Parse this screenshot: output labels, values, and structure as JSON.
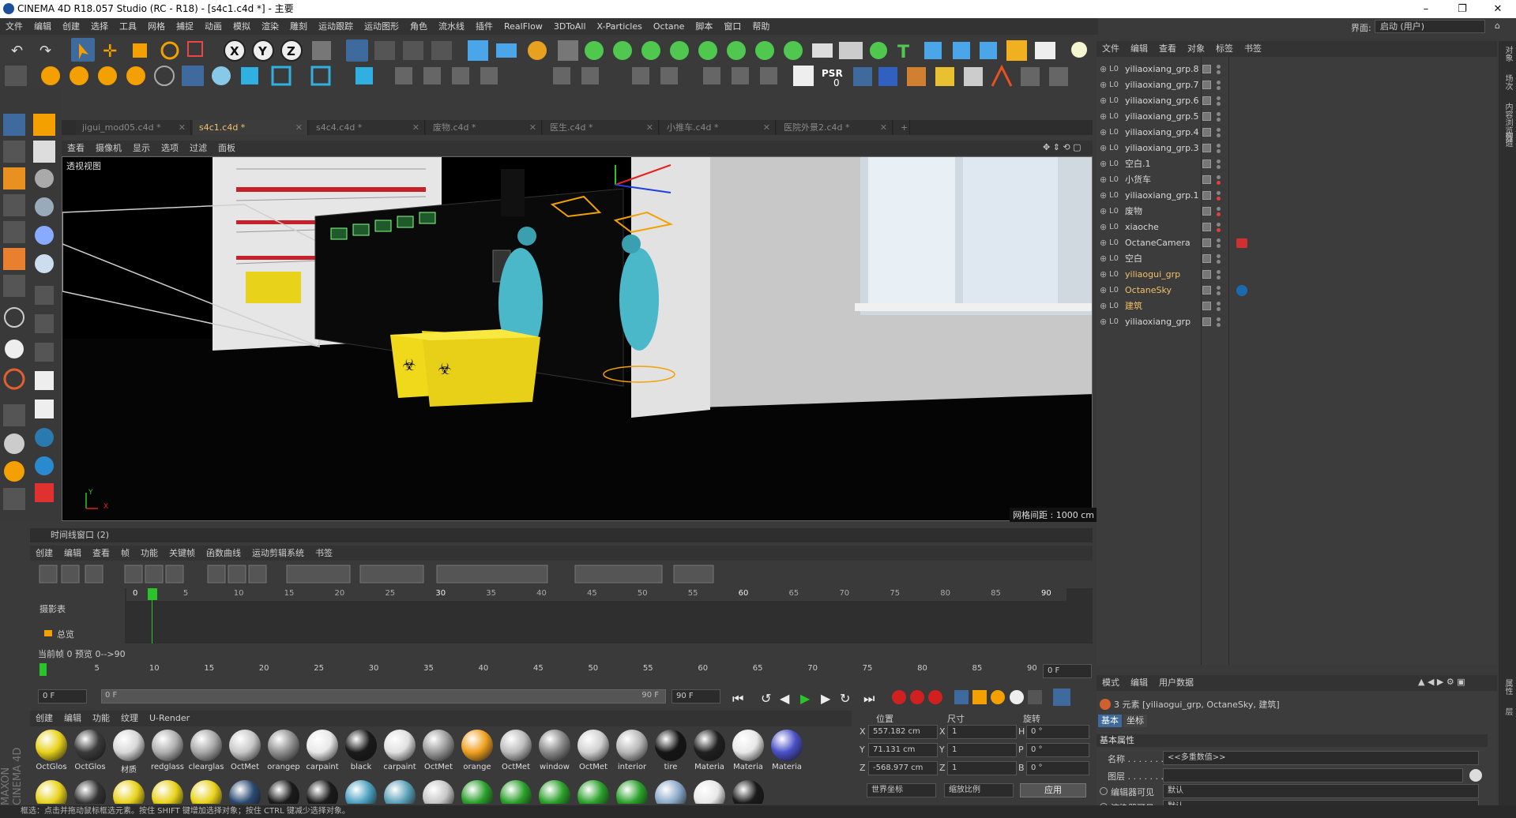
{
  "window": {
    "title": "CINEMA 4D R18.057 Studio (RC - R18) - [s4c1.c4d *] - 主要",
    "layout_label": "界面:",
    "layout_value": "启动 (用户)"
  },
  "menubar": [
    "文件",
    "编辑",
    "创建",
    "选择",
    "工具",
    "网格",
    "捕捉",
    "动画",
    "模拟",
    "渲染",
    "雕刻",
    "运动跟踪",
    "运动图形",
    "角色",
    "流水线",
    "插件",
    "RealFlow",
    "3DToAll",
    "X-Particles",
    "Octane",
    "脚本",
    "窗口",
    "帮助"
  ],
  "psr": {
    "label": "PSR",
    "value": "0"
  },
  "tabs": [
    {
      "label": "jigui_mod05.c4d *",
      "active": false
    },
    {
      "label": "s4c1.c4d *",
      "active": true
    },
    {
      "label": "s4c4.c4d *",
      "active": false
    },
    {
      "label": "废物.c4d *",
      "active": false
    },
    {
      "label": "医生.c4d *",
      "active": false
    },
    {
      "label": "小推车.c4d *",
      "active": false
    },
    {
      "label": "医院外景2.c4d *",
      "active": false
    }
  ],
  "viewport": {
    "menu": [
      "查看",
      "摄像机",
      "显示",
      "选项",
      "过滤",
      "面板"
    ],
    "label": "透视视图",
    "grid_info": "网格间距 : 1000 cm",
    "axis_y": "Y",
    "axis_x": "X"
  },
  "object_manager": {
    "menu": [
      "文件",
      "编辑",
      "查看",
      "对象",
      "标签",
      "书签"
    ],
    "objects": [
      {
        "name": "yiliaoxiang_grp.8",
        "highlight": false,
        "dot_color": "#888888"
      },
      {
        "name": "yiliaoxiang_grp.7",
        "highlight": false,
        "dot_color": "#888888"
      },
      {
        "name": "yiliaoxiang_grp.6",
        "highlight": false,
        "dot_color": "#888888"
      },
      {
        "name": "yiliaoxiang_grp.5",
        "highlight": false,
        "dot_color": "#888888"
      },
      {
        "name": "yiliaoxiang_grp.4",
        "highlight": false,
        "dot_color": "#888888"
      },
      {
        "name": "yiliaoxiang_grp.3",
        "highlight": false,
        "dot_color": "#888888"
      },
      {
        "name": "空白.1",
        "highlight": false,
        "dot_color": "#888888"
      },
      {
        "name": "小货车",
        "highlight": false,
        "dot_color": "#e04040"
      },
      {
        "name": "yiliaoxiang_grp.1",
        "highlight": false,
        "dot_color": "#e04040"
      },
      {
        "name": "废物",
        "highlight": false,
        "dot_color": "#e04040"
      },
      {
        "name": "xiaoche",
        "highlight": false,
        "dot_color": "#e04040"
      },
      {
        "name": "OctaneCamera",
        "highlight": false,
        "dot_color": "#888888"
      },
      {
        "name": "空白",
        "highlight": false,
        "dot_color": "#888888"
      },
      {
        "name": "yiliaogui_grp",
        "highlight": true,
        "dot_color": "#888888"
      },
      {
        "name": "OctaneSky",
        "highlight": true,
        "dot_color": "#888888"
      },
      {
        "name": "建筑",
        "highlight": true,
        "dot_color": "#888888"
      },
      {
        "name": "yiliaoxiang_grp",
        "highlight": false,
        "dot_color": "#888888"
      }
    ]
  },
  "vertical_tabs": [
    "对象",
    "场次",
    "内容浏览器",
    "构造"
  ],
  "vertical_tabs_bottom": [
    "属性",
    "层"
  ],
  "attribute_manager": {
    "menu": [
      "模式",
      "编辑",
      "用户数据"
    ],
    "selection": "3 元素 [yiliaogui_grp, OctaneSky, 建筑]",
    "tabs": [
      "基本",
      "坐标"
    ],
    "section": "基本属性",
    "fields": [
      {
        "label": "名称 . . . . . . .",
        "value": "<<多重数值>>"
      },
      {
        "label": "图层 . . . . . . .",
        "value": ""
      },
      {
        "label": "编辑器可见",
        "value": "默认"
      },
      {
        "label": "渲染器可见",
        "value": "默认"
      }
    ]
  },
  "timeline": {
    "title": "时间线窗口 (2)",
    "menu": [
      "创建",
      "编辑",
      "查看",
      "帧",
      "功能",
      "关键帧",
      "函数曲线",
      "运动剪辑系统",
      "书签"
    ],
    "track_header": "摄影表",
    "track_item": "总览",
    "ruler": [
      "0",
      "5",
      "10",
      "15",
      "20",
      "25",
      "30",
      "35",
      "40",
      "45",
      "50",
      "55",
      "60",
      "65",
      "70",
      "75",
      "80",
      "85",
      "90"
    ],
    "frame_info": "当前帧  0  预览  0-->90"
  },
  "ruler2": {
    "ticks": [
      "0",
      "5",
      "10",
      "15",
      "20",
      "25",
      "30",
      "35",
      "40",
      "45",
      "50",
      "55",
      "60",
      "65",
      "70",
      "75",
      "80",
      "85",
      "90"
    ],
    "current_frame": "0 F"
  },
  "transport": {
    "start": "0 F",
    "slider_left": "0 F",
    "slider_right": "90 F",
    "end": "90 F"
  },
  "materials": {
    "menu": [
      "创建",
      "编辑",
      "功能",
      "纹理",
      "U-Render"
    ],
    "row1": [
      {
        "label": "OctGlos",
        "color": "#e8d21a"
      },
      {
        "label": "OctGlos",
        "color": "#3a3a3a"
      },
      {
        "label": "材质",
        "color": "#d8d8d8"
      },
      {
        "label": "redglass",
        "color": "#b0b0b0"
      },
      {
        "label": "clearglas",
        "color": "#a8a8a8"
      },
      {
        "label": "OctMet",
        "color": "#c8c8c8"
      },
      {
        "label": "orangep",
        "color": "#909090"
      },
      {
        "label": "carpaint",
        "color": "#e8e8e8"
      },
      {
        "label": "black",
        "color": "#1a1a1a"
      },
      {
        "label": "carpaint",
        "color": "#e0e0e0"
      },
      {
        "label": "OctMet",
        "color": "#9a9a9a"
      },
      {
        "label": "orange",
        "color": "#f0a020"
      },
      {
        "label": "OctMet",
        "color": "#bcbcbc"
      },
      {
        "label": "window",
        "color": "#888888"
      },
      {
        "label": "OctMet",
        "color": "#d0d0d0"
      },
      {
        "label": "interior",
        "color": "#b8b8b8"
      },
      {
        "label": "tire",
        "color": "#151515"
      },
      {
        "label": "Materia",
        "color": "#202020"
      },
      {
        "label": "Materia",
        "color": "#e8e8e8"
      },
      {
        "label": "Materia",
        "color": "#4a50c8"
      }
    ],
    "row2_colors": [
      "#e8d21a",
      "#333333",
      "#e8d21a",
      "#e8d21a",
      "#e8d21a",
      "#2a4a70",
      "#1a1a1a",
      "#1a1a1a",
      "#4aa0c0",
      "#5aa0b8",
      "#c8c8c8",
      "#2aa02a",
      "#2aa02a",
      "#2aa02a",
      "#2aa02a",
      "#2aa02a",
      "#8aa8c8",
      "#e8e8e8",
      "#1a1a1a"
    ]
  },
  "coords": {
    "headers": [
      "位置",
      "尺寸",
      "旋转"
    ],
    "rows": [
      {
        "axis": "X",
        "pos": "557.182 cm",
        "size_axis": "X",
        "size": "1",
        "rot_axis": "H",
        "rot": "0 °"
      },
      {
        "axis": "Y",
        "pos": "71.131 cm",
        "size_axis": "Y",
        "size": "1",
        "rot_axis": "P",
        "rot": "0 °"
      },
      {
        "axis": "Z",
        "pos": "-568.977 cm",
        "size_axis": "Z",
        "size": "1",
        "rot_axis": "B",
        "rot": "0 °"
      }
    ],
    "mode": "世界坐标",
    "scale": "缩放比例",
    "apply": "应用"
  },
  "statusbar": "框选：点击并拖动鼠标框选元素。按住 SHIFT 键增加选择对象；按住 CTRL 键减少选择对象。",
  "brand": "MAXON CINEMA 4D"
}
